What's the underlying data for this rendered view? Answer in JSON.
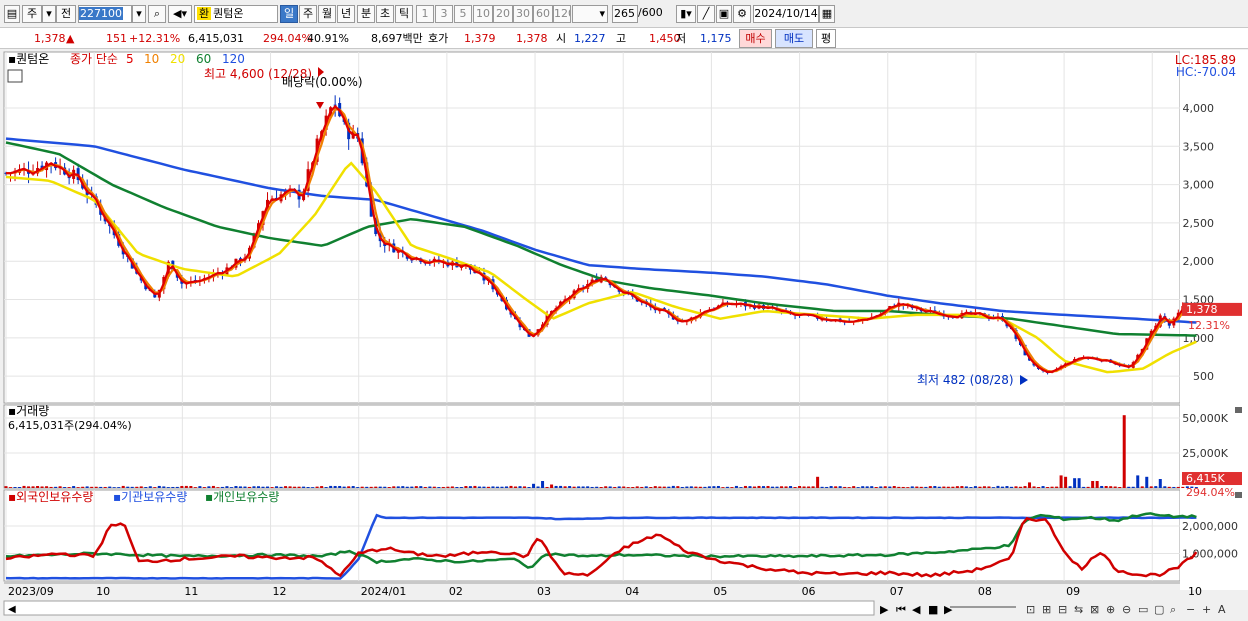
{
  "toolbar": {
    "period_label": "주",
    "prev_label": "전",
    "code": "227100",
    "search_icon": "search-icon",
    "sound_icon": "sound-icon",
    "stock_badge": "환",
    "stock_name": "퀀텀온",
    "periods": [
      "일",
      "주",
      "월",
      "년",
      "분",
      "초",
      "틱"
    ],
    "active_period": "일",
    "intervals": [
      "1",
      "3",
      "5",
      "10",
      "20",
      "30",
      "60",
      "120"
    ],
    "count": "265",
    "count_total": "/600",
    "date": "2024/10/14"
  },
  "quote": {
    "price": "1,378",
    "arrow": "▲",
    "change": "151",
    "change_pct": "+12.31%",
    "volume": "6,415,031",
    "volume_pct": "294.04%",
    "turnover": "40.91%",
    "amount": "8,697백만",
    "hoga_label": "호가",
    "ask": "1,379",
    "bid": "1,378",
    "open_label": "시",
    "open": "1,227",
    "high_label": "고",
    "high": "1,450",
    "low_label": "저",
    "low": "1,175",
    "buy_label": "매수",
    "sell_label": "매도",
    "eval_label": "평"
  },
  "colors": {
    "up": "#d00000",
    "down": "#0030c0",
    "ma5": "#e00000",
    "ma10": "#f08000",
    "ma20": "#f0e000",
    "ma60": "#108030",
    "ma120": "#2050e0"
  },
  "chart_data": [
    {
      "type": "candlestick",
      "title": "퀀텀온",
      "legend": {
        "price": "종가",
        "method": "단순",
        "periods": [
          "5",
          "10",
          "20",
          "60",
          "120"
        ]
      },
      "y_ticks": [
        "4,000",
        "3,500",
        "3,000",
        "2,500",
        "2,000",
        "1,500",
        "1,000",
        "500"
      ],
      "y_tick_values": [
        4000,
        3500,
        3000,
        2500,
        2000,
        1500,
        1000,
        500
      ],
      "ylim": [
        150,
        4600
      ],
      "lc_label": "LC:185.89",
      "hc_label": "HC:-70.04",
      "annotations": {
        "high_label": "최고 4,600 (12/28)",
        "low_label": "최저 482 (08/28)",
        "dividend_label": "배당락(0.00%)"
      },
      "current_price_tag": "1,378",
      "current_pct_tag": "12.31%",
      "current_price": 1378,
      "x_labels": [
        "2023/09",
        "10",
        "11",
        "12",
        "2024/01",
        "02",
        "03",
        "04",
        "05",
        "06",
        "07",
        "08",
        "09",
        "10"
      ],
      "x_label_months": [
        0,
        1,
        2,
        3,
        4,
        5,
        6,
        7,
        8,
        9,
        10,
        11,
        12,
        13
      ],
      "close_keypoints": [
        [
          0,
          3150
        ],
        [
          0.3,
          3200
        ],
        [
          0.5,
          3300
        ],
        [
          0.8,
          3100
        ],
        [
          1.1,
          2600
        ],
        [
          1.5,
          1800
        ],
        [
          1.7,
          1500
        ],
        [
          1.85,
          2000
        ],
        [
          2.0,
          1700
        ],
        [
          2.2,
          1750
        ],
        [
          2.5,
          1900
        ],
        [
          2.75,
          2100
        ],
        [
          2.95,
          2800
        ],
        [
          3.2,
          2900
        ],
        [
          3.35,
          2850
        ],
        [
          3.55,
          3600
        ],
        [
          3.72,
          4100
        ],
        [
          3.85,
          3700
        ],
        [
          4.0,
          3600
        ],
        [
          4.1,
          2900
        ],
        [
          4.2,
          2300
        ],
        [
          4.5,
          2100
        ],
        [
          4.8,
          2000
        ],
        [
          5.2,
          1950
        ],
        [
          5.5,
          1700
        ],
        [
          5.8,
          1200
        ],
        [
          5.95,
          1000
        ],
        [
          6.15,
          1300
        ],
        [
          6.4,
          1550
        ],
        [
          6.6,
          1700
        ],
        [
          6.75,
          1800
        ],
        [
          7.0,
          1600
        ],
        [
          7.3,
          1400
        ],
        [
          7.7,
          1200
        ],
        [
          7.9,
          1350
        ],
        [
          8.2,
          1450
        ],
        [
          8.6,
          1400
        ],
        [
          8.9,
          1300
        ],
        [
          9.3,
          1250
        ],
        [
          9.6,
          1200
        ],
        [
          9.9,
          1300
        ],
        [
          10.1,
          1450
        ],
        [
          10.4,
          1350
        ],
        [
          10.7,
          1300
        ],
        [
          11.0,
          1300
        ],
        [
          11.3,
          1250
        ],
        [
          11.4,
          1100
        ],
        [
          11.6,
          700
        ],
        [
          11.8,
          520
        ],
        [
          12.0,
          650
        ],
        [
          12.2,
          750
        ],
        [
          12.5,
          700
        ],
        [
          12.75,
          600
        ],
        [
          12.95,
          1000
        ],
        [
          13.1,
          1300
        ],
        [
          13.2,
          1150
        ],
        [
          13.35,
          1400
        ],
        [
          13.5,
          1378
        ]
      ],
      "ma_keypoints": {
        "120": [
          [
            0,
            3600
          ],
          [
            1.0,
            3500
          ],
          [
            2.0,
            3200
          ],
          [
            3.0,
            2950
          ],
          [
            3.6,
            2850
          ],
          [
            4.2,
            2800
          ],
          [
            4.8,
            2600
          ],
          [
            5.4,
            2400
          ],
          [
            6.0,
            2150
          ],
          [
            6.6,
            1950
          ],
          [
            7.2,
            1900
          ],
          [
            8.0,
            1850
          ],
          [
            8.6,
            1800
          ],
          [
            9.3,
            1700
          ],
          [
            10.0,
            1550
          ],
          [
            10.6,
            1450
          ],
          [
            11.3,
            1350
          ],
          [
            12.0,
            1300
          ],
          [
            12.8,
            1250
          ],
          [
            13.5,
            1200
          ]
        ],
        "60": [
          [
            0,
            3550
          ],
          [
            0.6,
            3400
          ],
          [
            1.2,
            3000
          ],
          [
            1.8,
            2700
          ],
          [
            2.4,
            2450
          ],
          [
            3.0,
            2300
          ],
          [
            3.6,
            2200
          ],
          [
            4.1,
            2450
          ],
          [
            4.6,
            2550
          ],
          [
            5.2,
            2450
          ],
          [
            5.8,
            2200
          ],
          [
            6.3,
            1950
          ],
          [
            6.8,
            1750
          ],
          [
            7.3,
            1650
          ],
          [
            8.0,
            1550
          ],
          [
            8.6,
            1450
          ],
          [
            9.4,
            1350
          ],
          [
            10.0,
            1350
          ],
          [
            10.6,
            1300
          ],
          [
            11.4,
            1250
          ],
          [
            12.0,
            1150
          ],
          [
            12.6,
            1050
          ],
          [
            13.5,
            1030
          ]
        ],
        "20": [
          [
            0,
            3100
          ],
          [
            0.5,
            3050
          ],
          [
            1.0,
            2800
          ],
          [
            1.5,
            2100
          ],
          [
            2.0,
            1900
          ],
          [
            2.6,
            1800
          ],
          [
            3.1,
            2100
          ],
          [
            3.5,
            2600
          ],
          [
            3.9,
            3300
          ],
          [
            4.2,
            2900
          ],
          [
            4.6,
            2200
          ],
          [
            5.0,
            2050
          ],
          [
            5.5,
            1850
          ],
          [
            5.9,
            1500
          ],
          [
            6.2,
            1250
          ],
          [
            6.6,
            1450
          ],
          [
            7.1,
            1600
          ],
          [
            7.6,
            1400
          ],
          [
            8.1,
            1250
          ],
          [
            8.6,
            1350
          ],
          [
            9.2,
            1300
          ],
          [
            9.8,
            1250
          ],
          [
            10.3,
            1300
          ],
          [
            10.8,
            1300
          ],
          [
            11.3,
            1250
          ],
          [
            11.7,
            1000
          ],
          [
            12.0,
            700
          ],
          [
            12.5,
            550
          ],
          [
            12.9,
            600
          ],
          [
            13.2,
            800
          ],
          [
            13.5,
            950
          ]
        ]
      },
      "volume_panel": {
        "title": "거래량",
        "value_label": "6,415,031주(294.04%)",
        "y_ticks": [
          "50,000K",
          "25,000K"
        ],
        "y_tick_values": [
          50000,
          25000
        ],
        "ylim": [
          0,
          55000
        ],
        "last_tag": "6,415K",
        "last_pct_tag": "294.04%",
        "spikes": [
          [
            6.0,
            3000
          ],
          [
            6.1,
            5000
          ],
          [
            6.2,
            2500
          ],
          [
            9.2,
            8000
          ],
          [
            11.6,
            4000
          ],
          [
            11.95,
            9000
          ],
          [
            12.0,
            8000
          ],
          [
            12.15,
            7000
          ],
          [
            12.35,
            5000
          ],
          [
            12.7,
            52000
          ],
          [
            12.85,
            9000
          ],
          [
            12.95,
            8000
          ],
          [
            13.1,
            6415
          ]
        ]
      },
      "holding_panel": {
        "legend": [
          "외국인보유수량",
          "기관보유수량",
          "개인보유수량"
        ],
        "legend_colors": [
          "#d00000",
          "#2050e0",
          "#108030"
        ],
        "y_ticks": [
          "2,000,000",
          "1,000,000"
        ],
        "y_tick_values": [
          2000000,
          1000000
        ],
        "ylim": [
          0,
          2800000
        ],
        "institution_keypoints": [
          [
            0,
            100000
          ],
          [
            3.8,
            100000
          ],
          [
            4.0,
            800000
          ],
          [
            4.2,
            2400000
          ],
          [
            4.3,
            2300000
          ],
          [
            6.0,
            2300000
          ],
          [
            6.3,
            2250000
          ],
          [
            7.0,
            2300000
          ],
          [
            13.5,
            2300000
          ]
        ],
        "foreign_keypoints": [
          [
            0,
            800000
          ],
          [
            0.6,
            1000000
          ],
          [
            1.0,
            900000
          ],
          [
            1.2,
            2100000
          ],
          [
            1.35,
            2000000
          ],
          [
            1.5,
            700000
          ],
          [
            2.0,
            800000
          ],
          [
            2.6,
            900000
          ],
          [
            3.0,
            850000
          ],
          [
            3.5,
            850000
          ],
          [
            3.8,
            200000
          ],
          [
            4.0,
            1000000
          ],
          [
            4.3,
            1200000
          ],
          [
            4.6,
            1000000
          ],
          [
            5.0,
            900000
          ],
          [
            5.5,
            1100000
          ],
          [
            5.9,
            900000
          ],
          [
            6.05,
            1600000
          ],
          [
            6.3,
            300000
          ],
          [
            6.6,
            200000
          ],
          [
            7.0,
            1200000
          ],
          [
            7.4,
            1700000
          ],
          [
            7.7,
            1100000
          ],
          [
            8.0,
            800000
          ],
          [
            8.5,
            500000
          ],
          [
            9.0,
            300000
          ],
          [
            9.5,
            250000
          ],
          [
            10.0,
            300000
          ],
          [
            10.5,
            200000
          ],
          [
            11.0,
            400000
          ],
          [
            11.4,
            800000
          ],
          [
            11.55,
            2300000
          ],
          [
            11.8,
            2200000
          ],
          [
            12.0,
            1100000
          ],
          [
            12.2,
            400000
          ],
          [
            12.4,
            1100000
          ],
          [
            12.6,
            400000
          ],
          [
            12.9,
            200000
          ],
          [
            13.1,
            250000
          ],
          [
            13.3,
            500000
          ],
          [
            13.5,
            1000000
          ]
        ],
        "individual_keypoints": [
          [
            0,
            900000
          ],
          [
            1.0,
            1000000
          ],
          [
            2.0,
            900000
          ],
          [
            3.0,
            950000
          ],
          [
            3.6,
            900000
          ],
          [
            3.9,
            1100000
          ],
          [
            4.2,
            700000
          ],
          [
            4.6,
            800000
          ],
          [
            5.2,
            700000
          ],
          [
            5.8,
            800000
          ],
          [
            5.95,
            400000
          ],
          [
            6.1,
            1000000
          ],
          [
            6.6,
            900000
          ],
          [
            7.0,
            950000
          ],
          [
            8.0,
            900000
          ],
          [
            9.0,
            900000
          ],
          [
            10.0,
            950000
          ],
          [
            10.6,
            1050000
          ],
          [
            11.0,
            1150000
          ],
          [
            11.4,
            1300000
          ],
          [
            11.55,
            2200000
          ],
          [
            11.75,
            2400000
          ],
          [
            12.0,
            2250000
          ],
          [
            12.3,
            2300000
          ],
          [
            12.6,
            2200000
          ],
          [
            12.9,
            2450000
          ],
          [
            13.2,
            2350000
          ],
          [
            13.5,
            2350000
          ]
        ]
      }
    }
  ]
}
